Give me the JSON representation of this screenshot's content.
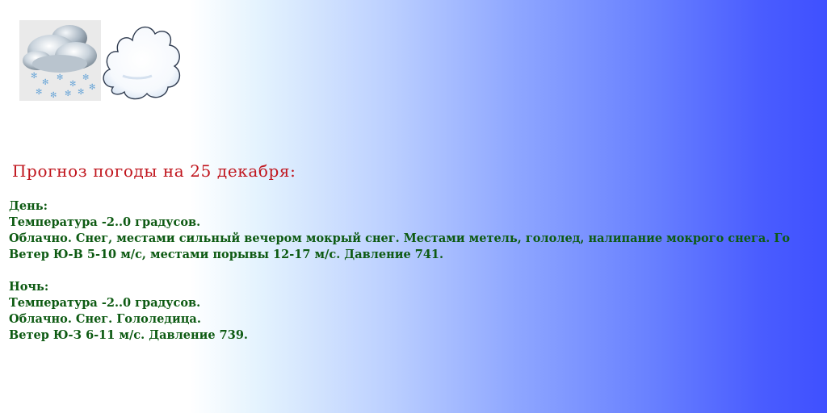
{
  "icons": {
    "condition_icon": "snow-cloud-icon",
    "cloud_icon": "cloud-icon"
  },
  "title": "Прогноз погоды на 25 декабря:",
  "day": {
    "heading": "День:",
    "temperature": "Температура -2..0 градусов.",
    "conditions": "Облачно. Снег, местами сильный вечером мокрый снег. Местами метель, гололед, налипание мокрого снега. Го",
    "wind": "Ветер Ю-В 5-10 м/с, местами порывы 12-17 м/с. Давление 741."
  },
  "night": {
    "heading": "Ночь:",
    "temperature": "Температура -2..0 градусов.",
    "conditions": "Облачно. Снег. Гололедица.",
    "wind": "Ветер Ю-З 6-11 м/с. Давление 739."
  },
  "colors": {
    "title": "#c0141c",
    "text": "#0d5a12",
    "gradient_end": "#3f50ff"
  }
}
